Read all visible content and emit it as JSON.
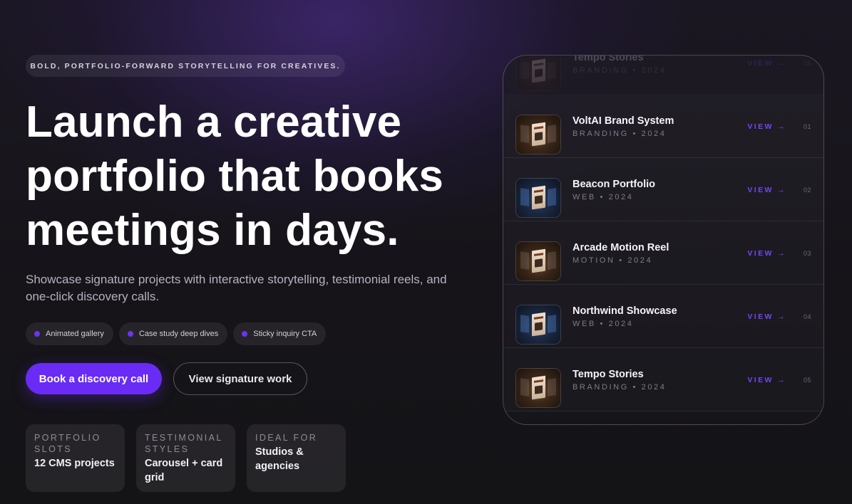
{
  "hero": {
    "eyebrow": "BOLD, PORTFOLIO-FORWARD STORYTELLING FOR CREATIVES.",
    "headline": "Launch a creative portfolio that books meetings in days.",
    "subtext": "Showcase signature projects with interactive storytelling, testimonial reels, and one-click discovery calls.",
    "chips": [
      {
        "label": "Animated gallery"
      },
      {
        "label": "Case study deep dives"
      },
      {
        "label": "Sticky inquiry CTA"
      }
    ],
    "primary_cta": "Book a discovery call",
    "secondary_cta": "View signature work",
    "stats": [
      {
        "label": "PORTFOLIO SLOTS",
        "value": "12 CMS projects"
      },
      {
        "label": "TESTIMONIAL STYLES",
        "value": "Carousel + card grid"
      },
      {
        "label": "IDEAL FOR",
        "value": "Studios & agencies"
      }
    ]
  },
  "showcase": {
    "view_label": "VIEW →",
    "projects": [
      {
        "title": "Tempo Stories",
        "meta": "BRANDING • 2024",
        "number": "05",
        "thumb_style": "warm"
      },
      {
        "title": "VoltAI Brand System",
        "meta": "BRANDING • 2024",
        "number": "01",
        "thumb_style": "warm"
      },
      {
        "title": "Beacon Portfolio",
        "meta": "WEB • 2024",
        "number": "02",
        "thumb_style": "cool"
      },
      {
        "title": "Arcade Motion Reel",
        "meta": "MOTION • 2024",
        "number": "03",
        "thumb_style": "warm"
      },
      {
        "title": "Northwind Showcase",
        "meta": "WEB • 2024",
        "number": "04",
        "thumb_style": "cool"
      },
      {
        "title": "Tempo Stories",
        "meta": "BRANDING • 2024",
        "number": "05",
        "thumb_style": "warm"
      }
    ]
  },
  "colors": {
    "accent": "#6a2bf5",
    "view_link": "#7446f6",
    "background": "#161419"
  }
}
